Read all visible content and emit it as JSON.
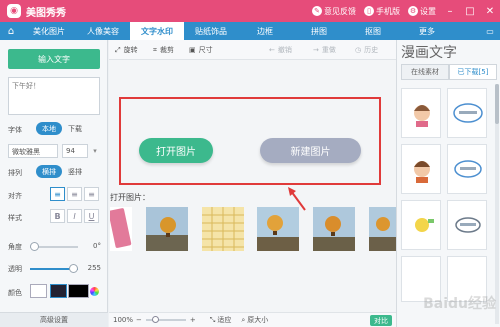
{
  "titlebar": {
    "app_title": "美图秀秀",
    "feedback": "意见反馈",
    "phone": "手机版",
    "settings": "设置"
  },
  "nav": {
    "tabs": [
      {
        "label": "美化图片"
      },
      {
        "label": "人像美容"
      },
      {
        "label": "文字水印"
      },
      {
        "label": "贴纸饰品"
      },
      {
        "label": "边框"
      },
      {
        "label": "拼图"
      },
      {
        "label": "抠图"
      },
      {
        "label": "更多"
      }
    ],
    "active_index": 2
  },
  "left_panel": {
    "input_button": "输入文字",
    "text_value": "下午好！",
    "font_label": "字体",
    "font_local": "本地",
    "font_download": "下载",
    "font_name": "微软雅黑",
    "font_size": "94",
    "layout_label": "排列",
    "layout_horizontal": "横排",
    "layout_vertical": "竖排",
    "align_label": "对齐",
    "style_label": "样式",
    "style_bold": "B",
    "style_italic": "I",
    "style_underline": "U",
    "angle_label": "角度",
    "angle_value": "0°",
    "angle_fraction": 0.0,
    "opacity_label": "透明",
    "opacity_value": "255",
    "opacity_fraction": 1.0,
    "color_label": "颜色",
    "advanced": "高级设置"
  },
  "toolbar": {
    "rotate": "旋转",
    "crop": "裁剪",
    "size": "尺寸",
    "undo": "撤销",
    "redo": "重做",
    "history": "历史"
  },
  "canvas": {
    "open_button": "打开图片",
    "new_button": "新建图片",
    "open_label": "打开图片："
  },
  "zoombar": {
    "zoom": "100%",
    "fit": "适应",
    "actual": "原大小",
    "compare": "对比"
  },
  "right_panel": {
    "title": "漫画文字",
    "tab_online": "在线素材",
    "tab_downloaded": "已下载[5]"
  },
  "watermark": "Baidu经验",
  "colors": {
    "brand_pink": "#e64c7a",
    "nav_blue": "#2f8ecb",
    "accent_green": "#3cb98d",
    "highlight_red": "#e03a3a",
    "button_gray": "#a5acc1"
  }
}
